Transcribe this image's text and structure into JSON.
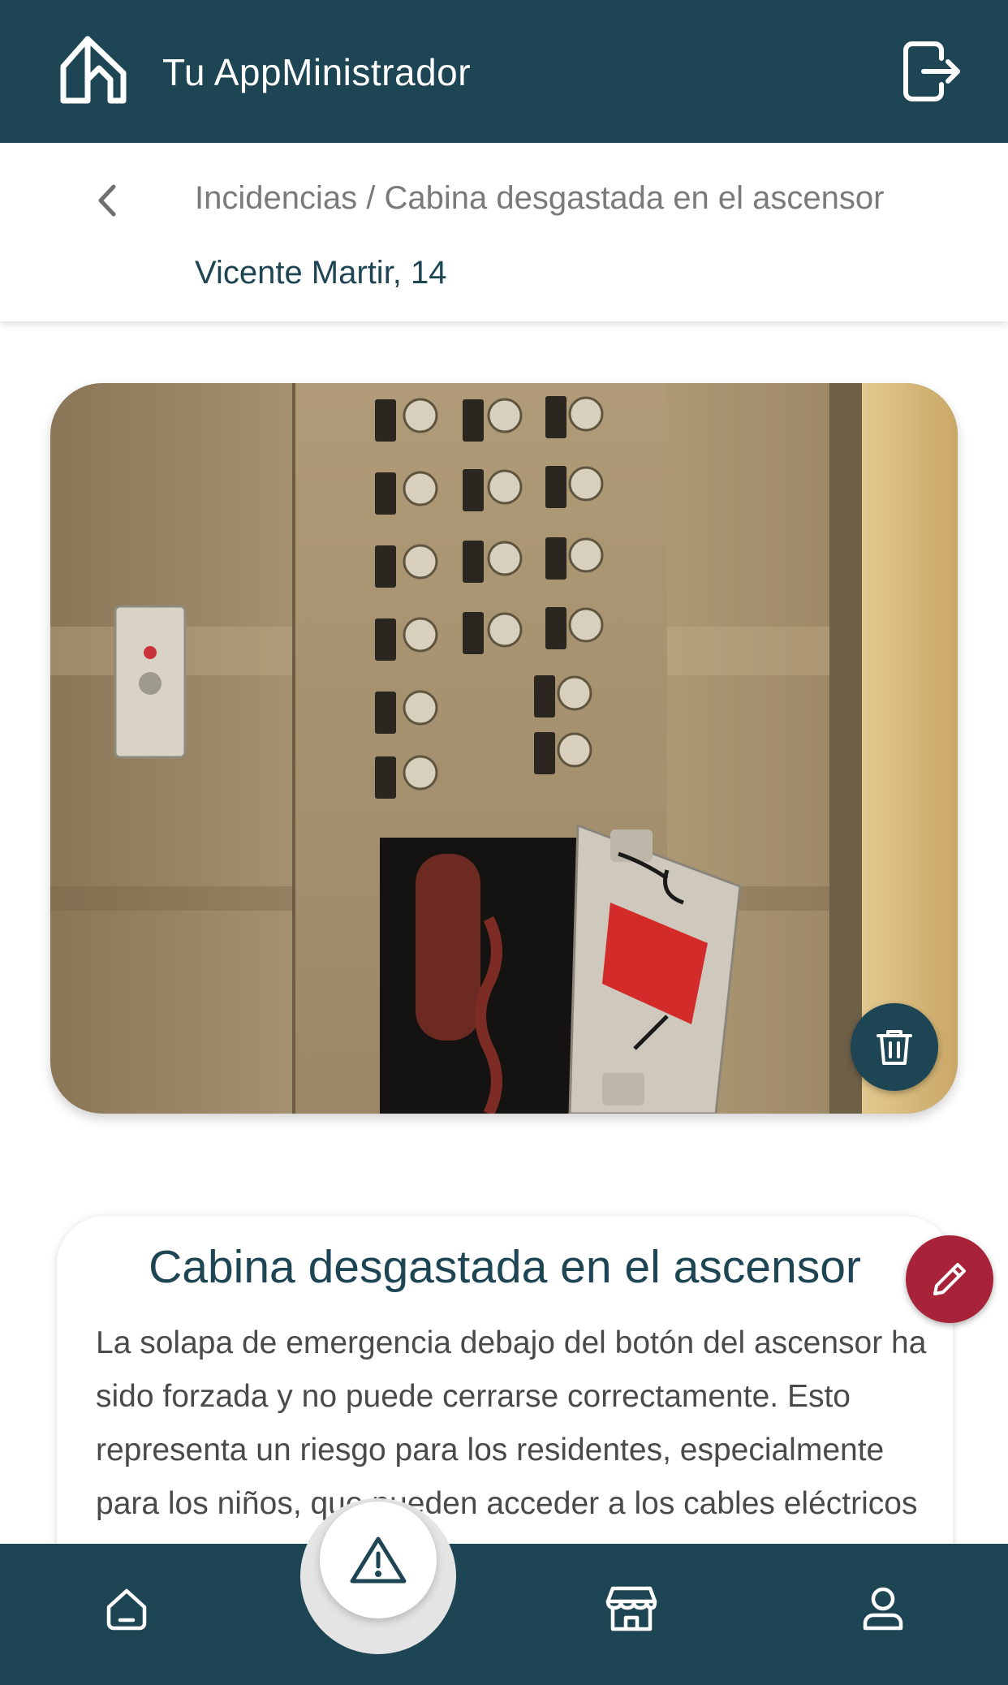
{
  "header": {
    "app_title": "Tu AppMinistrador",
    "logo_icon": "house-outline-logo-icon",
    "logout_icon": "logout-icon"
  },
  "subheader": {
    "back_icon": "chevron-left-icon",
    "breadcrumb": "Incidencias / Cabina desgastada en el ascensor",
    "address": "Vicente Martir, 14"
  },
  "photo": {
    "subject": "elevator-panel-photo",
    "delete_icon": "trash-icon"
  },
  "incident": {
    "title": "Cabina desgastada en el ascensor",
    "description": "La solapa de emergencia debajo del botón del ascensor ha sido forzada y no puede cerrarse correctamente. Esto representa un riesgo para los residentes, especialmente para los niños, que pueden acceder a los cables eléctricos del sistema y resultar"
  },
  "actions": {
    "edit_icon": "pencil-icon",
    "report_icon": "warning-triangle-icon"
  },
  "bottom_nav": {
    "items": [
      {
        "icon": "home-icon"
      },
      {
        "icon": "warning-triangle-icon"
      },
      {
        "icon": "store-icon"
      },
      {
        "icon": "user-icon"
      }
    ]
  },
  "colors": {
    "primary": "#1e4554",
    "accent": "#a8233a",
    "breadcrumb": "#7a7a7a",
    "body_text": "#4a4a4a"
  }
}
